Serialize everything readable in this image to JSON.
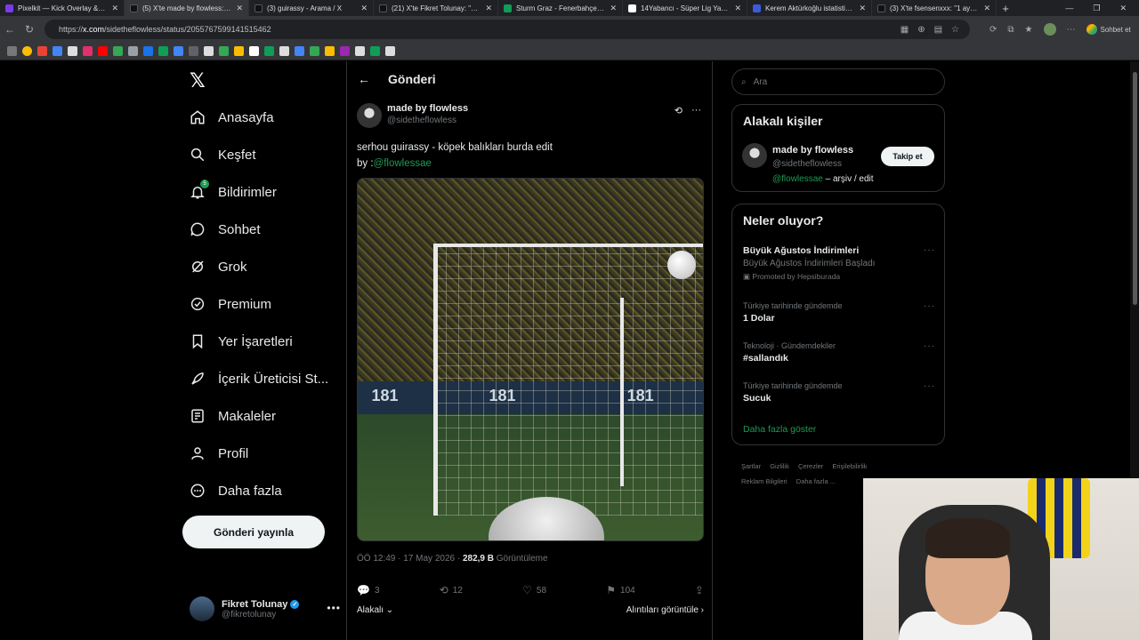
{
  "browser": {
    "tabs": [
      {
        "title": "Pixelkit — Kick Overlay & Bot",
        "color": "#7c3aed"
      },
      {
        "title": "(5) X'te made by flowless: \"serh",
        "color": "#000000",
        "active": true
      },
      {
        "title": "(3) guirassy - Arama / X",
        "color": "#000000"
      },
      {
        "title": "(21) X'te Fikret Tolunay: \"@keys",
        "color": "#000000"
      },
      {
        "title": "Sturm Graz - Fenerbahçe canlı",
        "color": "#0f9d58"
      },
      {
        "title": "14Yabancı - Süper Lig Yabancı",
        "color": "#ffffff"
      },
      {
        "title": "Kerem Aktürkoğlu istatistikleri",
        "color": "#3b5bdb"
      },
      {
        "title": "(3) X'te fsensenxxx: \"1 aydır Fen",
        "color": "#000000"
      }
    ],
    "url_prefix": "https://",
    "url_domain": "x.com",
    "url_path": "/sidetheflowless/status/2055767599141515462",
    "sohbet_label": "Sohbet et"
  },
  "nav": {
    "items": [
      {
        "label": "Anasayfa",
        "icon": "home-icon"
      },
      {
        "label": "Keşfet",
        "icon": "search-icon"
      },
      {
        "label": "Bildirimler",
        "icon": "bell-icon",
        "badge": "5"
      },
      {
        "label": "Sohbet",
        "icon": "chat-icon"
      },
      {
        "label": "Grok",
        "icon": "grok-icon"
      },
      {
        "label": "Premium",
        "icon": "premium-icon"
      },
      {
        "label": "Yer İşaretleri",
        "icon": "bookmark-icon"
      },
      {
        "label": "İçerik Üreticisi St...",
        "icon": "rocket-icon"
      },
      {
        "label": "Makaleler",
        "icon": "article-icon"
      },
      {
        "label": "Profil",
        "icon": "person-icon"
      },
      {
        "label": "Daha fazla",
        "icon": "more-circle-icon"
      }
    ],
    "post_button": "Gönderi yayınla",
    "me": {
      "name": "Fikret Tolunay",
      "handle": "@fikretolunay"
    }
  },
  "post": {
    "header_title": "Gönderi",
    "author_name": "made by flowless",
    "author_handle": "@sidetheflowless",
    "text_line1": "serhou guirassy - köpek balıkları burda edit",
    "text_by": "by :",
    "text_mention": "@flowlessae",
    "media_boards": [
      "181",
      "181",
      "181"
    ],
    "time": "ÖÖ 12:49 · 17 May 2026 · ",
    "views_count": "282,9 B",
    "views_label": " Görüntüleme",
    "replies": "3",
    "reposts": "12",
    "likes": "58",
    "bookmarks": "104",
    "sort_label": "Alakalı",
    "quotes_label": "Alıntıları görüntüle"
  },
  "right": {
    "search_placeholder": "Ara",
    "relevant_title": "Alakalı kişiler",
    "relevant": {
      "name": "made by flowless",
      "handle": "@sidetheflowless",
      "bio_mention": "@flowlessae",
      "bio_rest": " – arşiv / edit",
      "follow": "Takip et"
    },
    "trending_title": "Neler oluyor?",
    "trends": [
      {
        "name": "Büyük Ağustos İndirimleri",
        "sub": "Büyük Ağustos İndirimleri Başladı",
        "promo": "Promoted by Hepsiburada"
      },
      {
        "ctx": "Türkiye tarihinde gündemde",
        "name": "1 Dolar"
      },
      {
        "ctx": "Teknoloji · Gündemdekiler",
        "name": "#sallandık"
      },
      {
        "ctx": "Türkiye tarihinde gündemde",
        "name": "Sucuk"
      }
    ],
    "show_more": "Daha fazla göster",
    "footer": [
      "Şartlar",
      "Gizlilik",
      "Çerezler",
      "Erişilebilirlik",
      "Reklam Bilgileri",
      "Daha fazla ..."
    ]
  }
}
